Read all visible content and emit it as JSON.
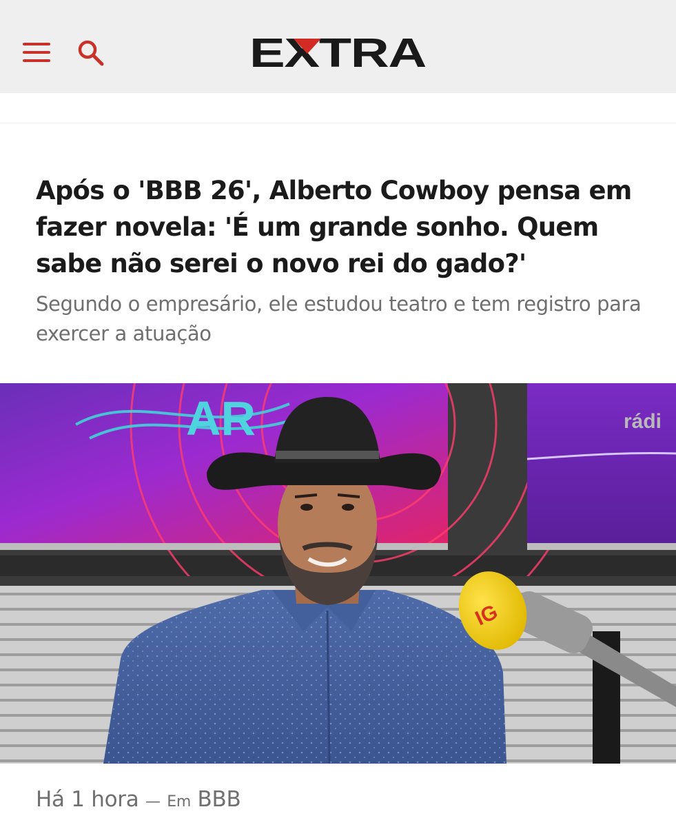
{
  "header": {
    "logo_text": "EXTRA",
    "menu_icon": "hamburger-menu-icon",
    "search_icon": "search-icon",
    "accent_color": "#c8322b"
  },
  "article": {
    "headline": "Após o 'BBB 26', Alberto Cowboy pensa em fazer novela: 'É um grande sonho. Quem sabe não serei o novo rei do gado?'",
    "subtitle": "Segundo o empresário, ele estudou teatro e tem registro para exercer a atuação",
    "photo": {
      "background_screen_text_left": "AR",
      "background_screen_text_right": "rádi",
      "microphone_logo": "IG"
    },
    "meta": {
      "time": "Há 1 hora",
      "separator": "—",
      "section_prefix": "Em",
      "section": "BBB"
    }
  }
}
